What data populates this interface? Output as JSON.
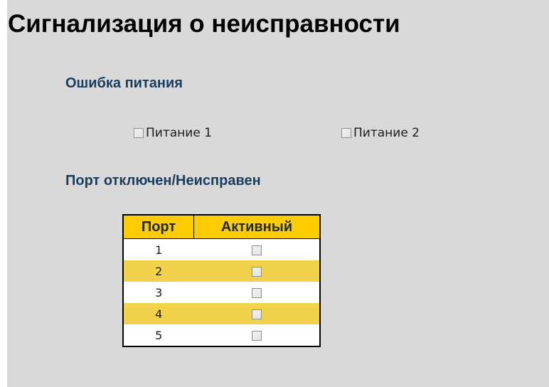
{
  "page": {
    "title": "Сигнализация о неисправности"
  },
  "power_failure": {
    "title": "Ошибка питания",
    "options": [
      {
        "label": "Питание 1",
        "checked": false
      },
      {
        "label": "Питание 2",
        "checked": false
      }
    ]
  },
  "port_fault": {
    "title": "Порт отключен/Неисправен",
    "columns": [
      "Порт",
      "Активный"
    ],
    "rows": [
      {
        "port": "1",
        "active": false
      },
      {
        "port": "2",
        "active": false
      },
      {
        "port": "3",
        "active": false
      },
      {
        "port": "4",
        "active": false
      },
      {
        "port": "5",
        "active": false
      }
    ]
  },
  "colors": {
    "background": "#d9d9d9",
    "section_title": "#1b3d5c",
    "table_header": "#ffcc00",
    "row_alt": "#f2d24a",
    "row": "#ffffff"
  }
}
